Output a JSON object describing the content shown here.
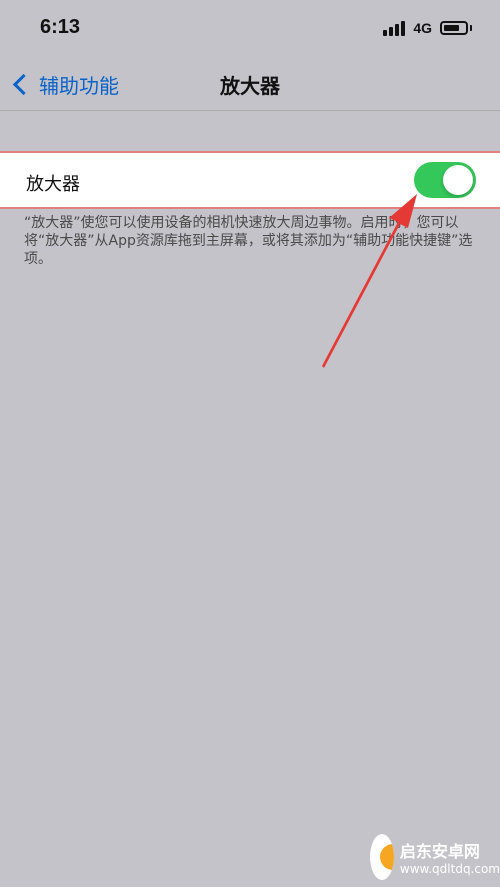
{
  "status_bar": {
    "time": "6:13",
    "network": "4G",
    "battery_level": 0.75
  },
  "nav": {
    "back_label": "辅助功能",
    "title": "放大器"
  },
  "setting": {
    "label": "放大器",
    "toggle_on": true
  },
  "description": "“放大器”使您可以使用设备的相机快速放大周边事物。启用时，您可以将“放大器”从App资源库拖到主屏幕，或将其添加为“辅助功能快捷键”选项。",
  "watermark": {
    "name": "启东安卓网",
    "url": "www.qdltdq.com"
  },
  "colors": {
    "background": "#c4c3c9",
    "accent": "#0a63c9",
    "toggle_on": "#34c759",
    "arrow": "#e53935",
    "highlight_border": "#e08080"
  }
}
